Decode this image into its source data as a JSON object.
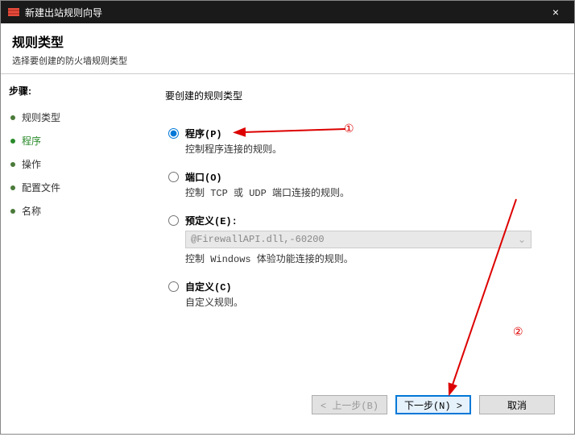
{
  "window": {
    "title": "新建出站规则向导",
    "close": "×"
  },
  "header": {
    "title": "规则类型",
    "subtitle": "选择要创建的防火墙规则类型"
  },
  "sidebar": {
    "steps_title": "步骤:",
    "items": [
      {
        "label": "规则类型"
      },
      {
        "label": "程序"
      },
      {
        "label": "操作"
      },
      {
        "label": "配置文件"
      },
      {
        "label": "名称"
      }
    ]
  },
  "content": {
    "title": "要创建的规则类型",
    "options": [
      {
        "label": "程序(P)",
        "desc": "控制程序连接的规则。"
      },
      {
        "label": "端口(O)",
        "desc": "控制 TCP 或 UDP 端口连接的规则。"
      },
      {
        "label": "预定义(E):",
        "desc": "控制 Windows 体验功能连接的规则。"
      },
      {
        "label": "自定义(C)",
        "desc": "自定义规则。"
      }
    ],
    "predefined_value": "@FirewallAPI.dll,-60200"
  },
  "footer": {
    "back": "< 上一步(B)",
    "next": "下一步(N) >",
    "cancel": "取消"
  },
  "annotations": {
    "num1": "①",
    "num2": "②"
  }
}
